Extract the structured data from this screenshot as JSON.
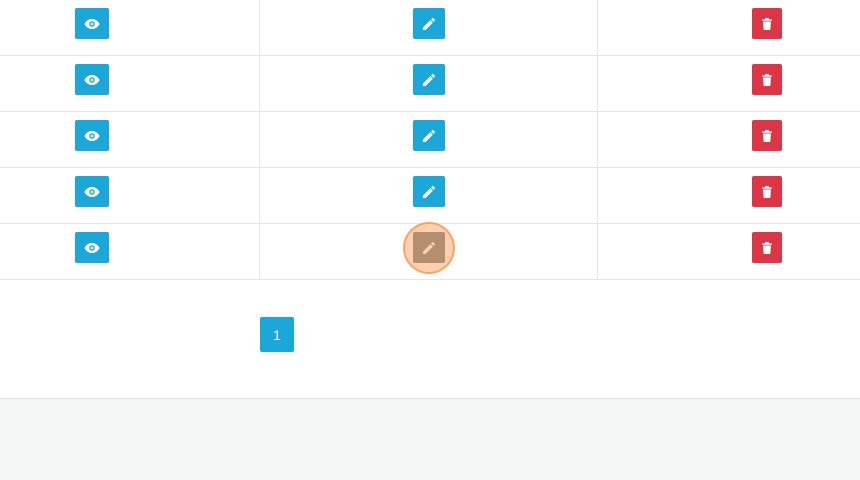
{
  "colors": {
    "info": "#1ba8d8",
    "danger": "#dc3545",
    "focused": "#5d6d72",
    "highlight": "#f7a35c"
  },
  "icons": {
    "view": "eye-icon",
    "edit": "pencil-icon",
    "delete": "trash-icon"
  },
  "table": {
    "rows": [
      {
        "view": "view",
        "edit": "edit",
        "delete": "delete",
        "edit_state": "normal"
      },
      {
        "view": "view",
        "edit": "edit",
        "delete": "delete",
        "edit_state": "normal"
      },
      {
        "view": "view",
        "edit": "edit",
        "delete": "delete",
        "edit_state": "normal"
      },
      {
        "view": "view",
        "edit": "edit",
        "delete": "delete",
        "edit_state": "normal"
      },
      {
        "view": "view",
        "edit": "edit",
        "delete": "delete",
        "edit_state": "clicked"
      }
    ]
  },
  "pagination": {
    "current_page": "1"
  }
}
